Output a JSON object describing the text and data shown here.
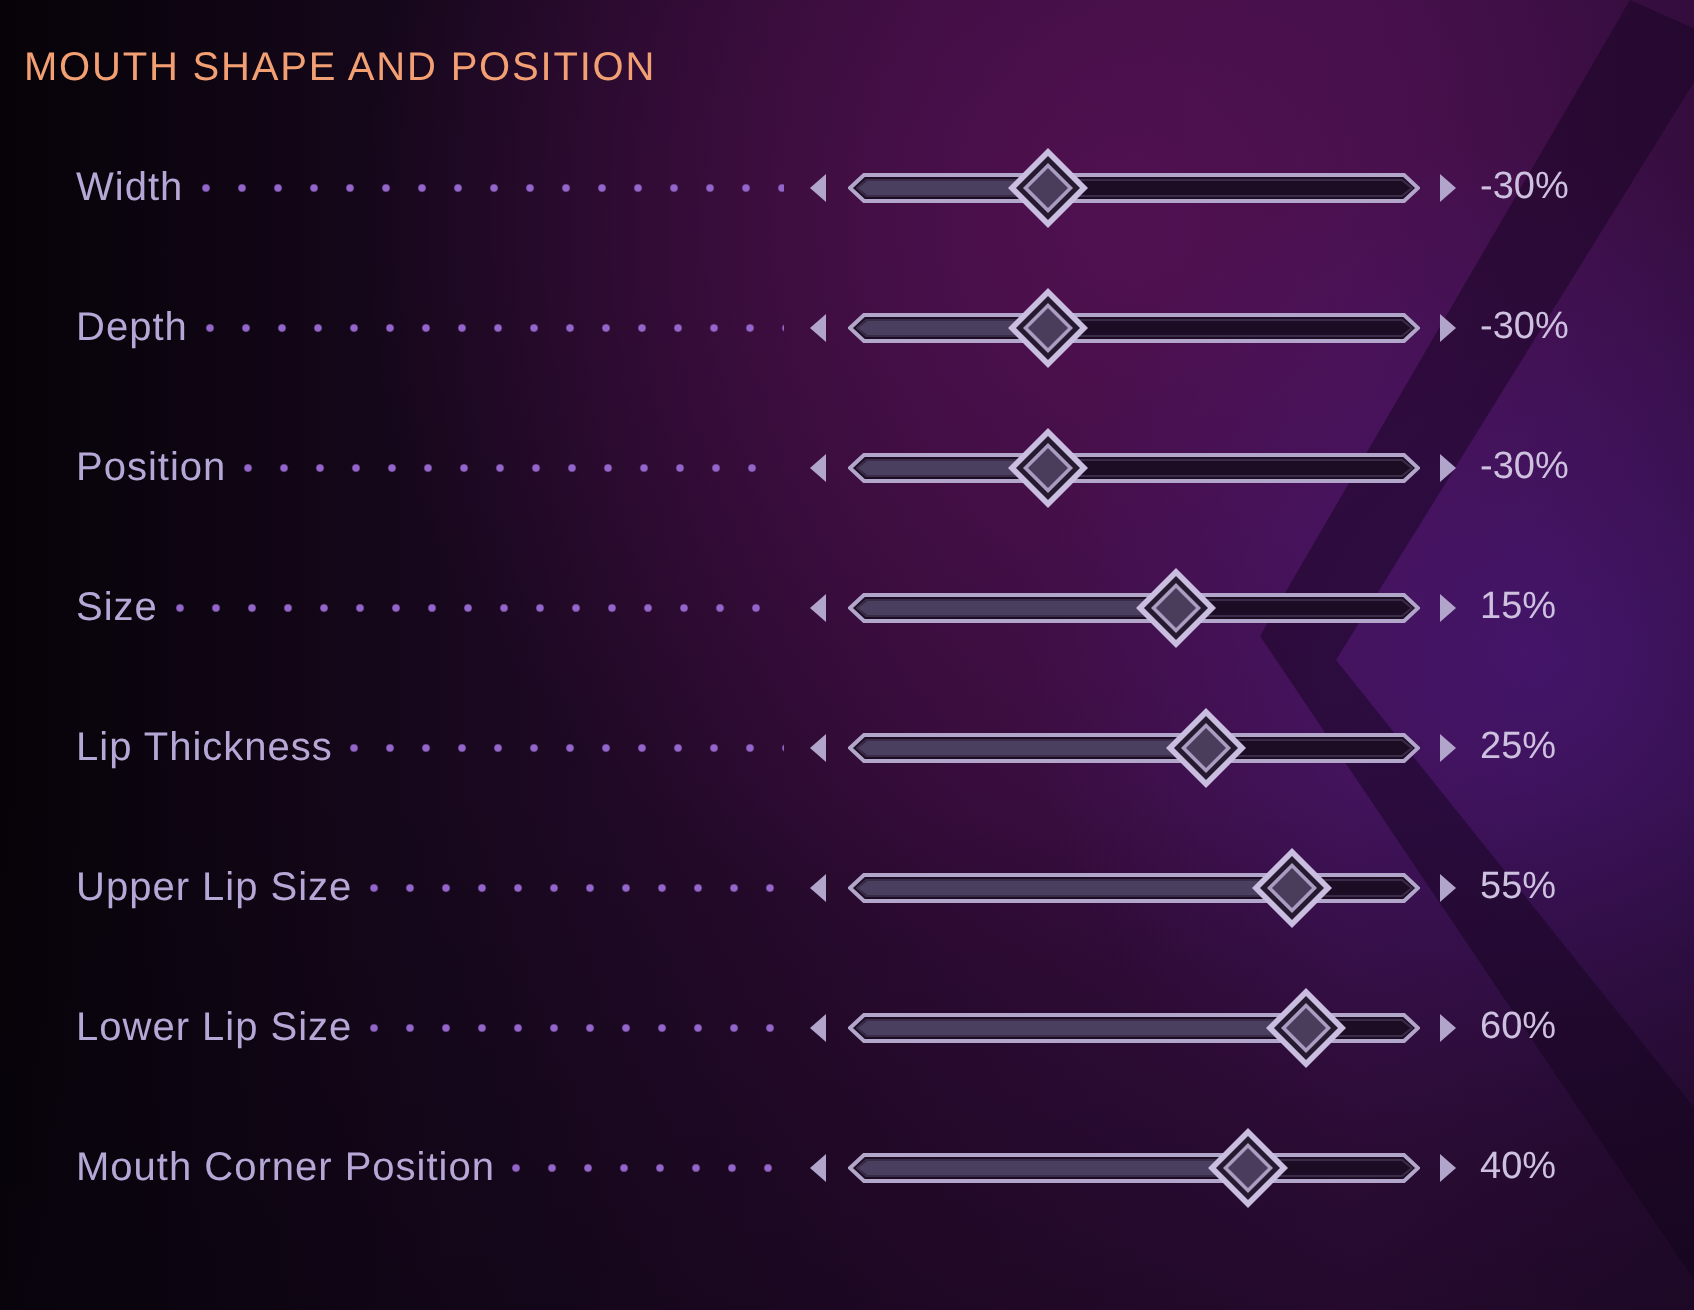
{
  "section": {
    "title": "MOUTH SHAPE AND POSITION"
  },
  "sliders": [
    {
      "label": "Width",
      "level": 0.35,
      "value": "-30%"
    },
    {
      "label": "Depth",
      "level": 0.35,
      "value": "-30%"
    },
    {
      "label": "Position",
      "level": 0.35,
      "value": "-30%"
    },
    {
      "label": "Size",
      "level": 0.575,
      "value": "15%"
    },
    {
      "label": "Lip Thickness",
      "level": 0.625,
      "value": "25%"
    },
    {
      "label": "Upper Lip Size",
      "level": 0.775,
      "value": "55%"
    },
    {
      "label": "Lower Lip Size",
      "level": 0.8,
      "value": "60%"
    },
    {
      "label": "Mouth Corner Position",
      "level": 0.7,
      "value": "40%"
    }
  ]
}
